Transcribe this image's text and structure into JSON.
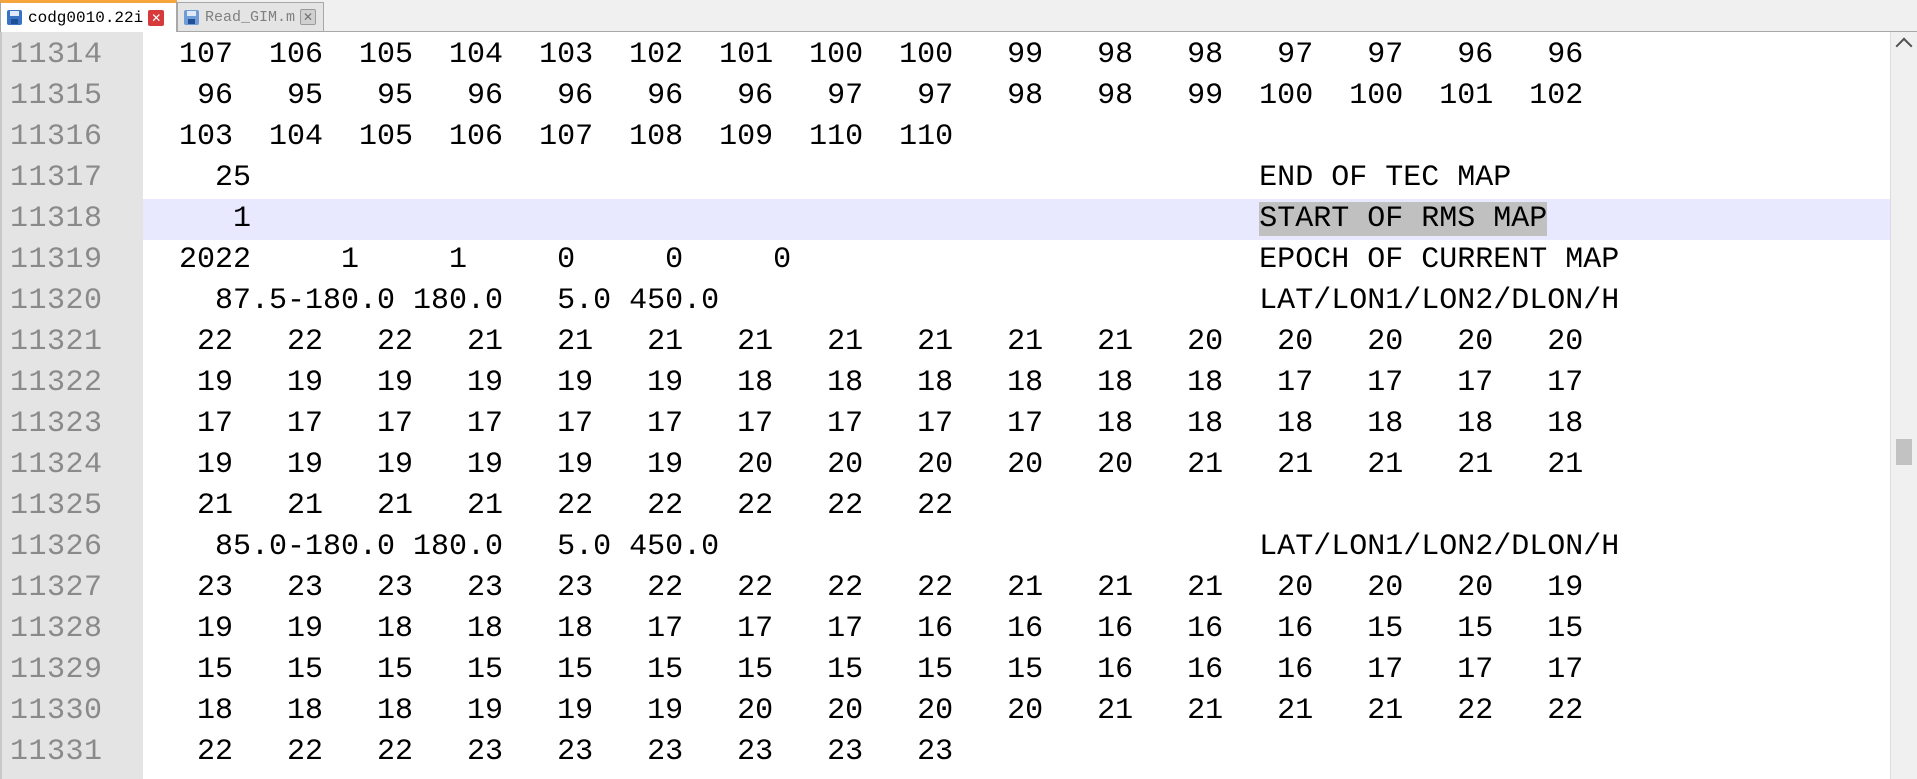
{
  "tabs": [
    {
      "label": "codg0010.22i",
      "active": true
    },
    {
      "label": "Read_GIM.m",
      "active": false
    }
  ],
  "editor": {
    "current_line": "11318",
    "selected_text": "START OF RMS MAP",
    "lines": [
      {
        "number": "11314",
        "text": "  107  106  105  104  103  102  101  100  100   99   98   98   97   97   96   96"
      },
      {
        "number": "11315",
        "text": "   96   95   95   96   96   96   96   97   97   98   98   99  100  100  101  102"
      },
      {
        "number": "11316",
        "text": "  103  104  105  106  107  108  109  110  110"
      },
      {
        "number": "11317",
        "text": "    25                                                        END OF TEC MAP"
      },
      {
        "number": "11318",
        "text": "     1                                                        ",
        "selected": "START OF RMS MAP"
      },
      {
        "number": "11319",
        "text": "  2022     1     1     0     0     0                          EPOCH OF CURRENT MAP"
      },
      {
        "number": "11320",
        "text": "    87.5-180.0 180.0   5.0 450.0                              LAT/LON1/LON2/DLON/H"
      },
      {
        "number": "11321",
        "text": "   22   22   22   21   21   21   21   21   21   21   21   20   20   20   20   20"
      },
      {
        "number": "11322",
        "text": "   19   19   19   19   19   19   18   18   18   18   18   18   17   17   17   17"
      },
      {
        "number": "11323",
        "text": "   17   17   17   17   17   17   17   17   17   17   18   18   18   18   18   18"
      },
      {
        "number": "11324",
        "text": "   19   19   19   19   19   19   20   20   20   20   20   21   21   21   21   21"
      },
      {
        "number": "11325",
        "text": "   21   21   21   21   22   22   22   22   22"
      },
      {
        "number": "11326",
        "text": "    85.0-180.0 180.0   5.0 450.0                              LAT/LON1/LON2/DLON/H"
      },
      {
        "number": "11327",
        "text": "   23   23   23   23   23   22   22   22   22   21   21   21   20   20   20   19"
      },
      {
        "number": "11328",
        "text": "   19   19   18   18   18   17   17   17   16   16   16   16   16   15   15   15"
      },
      {
        "number": "11329",
        "text": "   15   15   15   15   15   15   15   15   15   15   16   16   16   17   17   17"
      },
      {
        "number": "11330",
        "text": "   18   18   18   19   19   19   20   20   20   20   21   21   21   21   22   22"
      },
      {
        "number": "11331",
        "text": "   22   22   22   23   23   23   23   23   23"
      }
    ]
  },
  "icons": {
    "tab_file": "save-disk-icon",
    "tab_close": "close-icon",
    "scroll_up": "chevron-up-icon"
  },
  "colors": {
    "active_tab_accent": "#f5a53b",
    "current_line_highlight": "#e8e8ff",
    "selection": "#c0c0c0",
    "gutter": "#e4e4e4"
  }
}
